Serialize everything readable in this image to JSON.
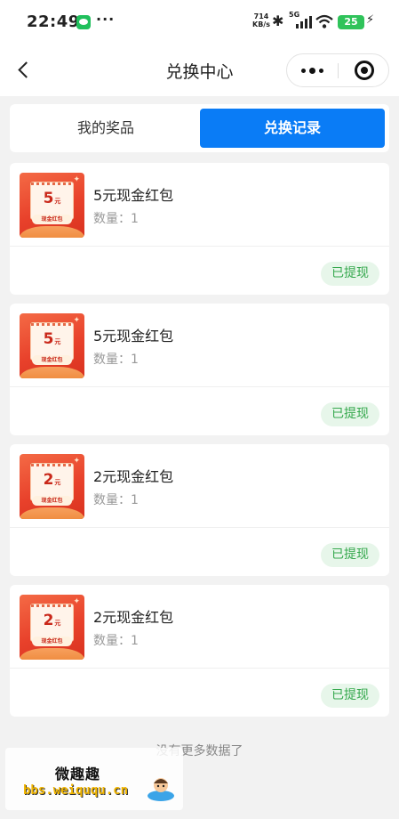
{
  "status_bar": {
    "time": "22:49",
    "more_dots": "···",
    "net_speed_value": "714",
    "net_speed_unit": "KB/s",
    "network": "5G",
    "battery": "25",
    "icons": [
      "wechat-icon",
      "bluetooth-icon",
      "signal-icon",
      "wifi-icon",
      "battery-icon",
      "charging-icon"
    ]
  },
  "nav": {
    "title": "兑换中心",
    "back_icon": "chevron-left-icon",
    "more_icon": "more-dots-icon",
    "close_icon": "target-close-icon"
  },
  "tabs": [
    {
      "label": "我的奖品",
      "active": false
    },
    {
      "label": "兑换记录",
      "active": true
    }
  ],
  "colors": {
    "accent": "#0a7cf6",
    "status_green": "#35a84d",
    "status_bg": "#e7f6ea",
    "red_packet": "#e8412b"
  },
  "records": [
    {
      "name": "5元现金红包",
      "quantity": "数量：1",
      "amount": "5",
      "unit": "元",
      "ribbon": "现金红包",
      "status": "已提现"
    },
    {
      "name": "5元现金红包",
      "quantity": "数量：1",
      "amount": "5",
      "unit": "元",
      "ribbon": "现金红包",
      "status": "已提现"
    },
    {
      "name": "2元现金红包",
      "quantity": "数量：1",
      "amount": "2",
      "unit": "元",
      "ribbon": "现金红包",
      "status": "已提现"
    },
    {
      "name": "2元现金红包",
      "quantity": "数量：1",
      "amount": "2",
      "unit": "元",
      "ribbon": "现金红包",
      "status": "已提现"
    }
  ],
  "footer": {
    "no_more": "没有更多数据了"
  },
  "watermark": {
    "title": "微趣趣",
    "url": "bbs.weiququ.cn"
  }
}
